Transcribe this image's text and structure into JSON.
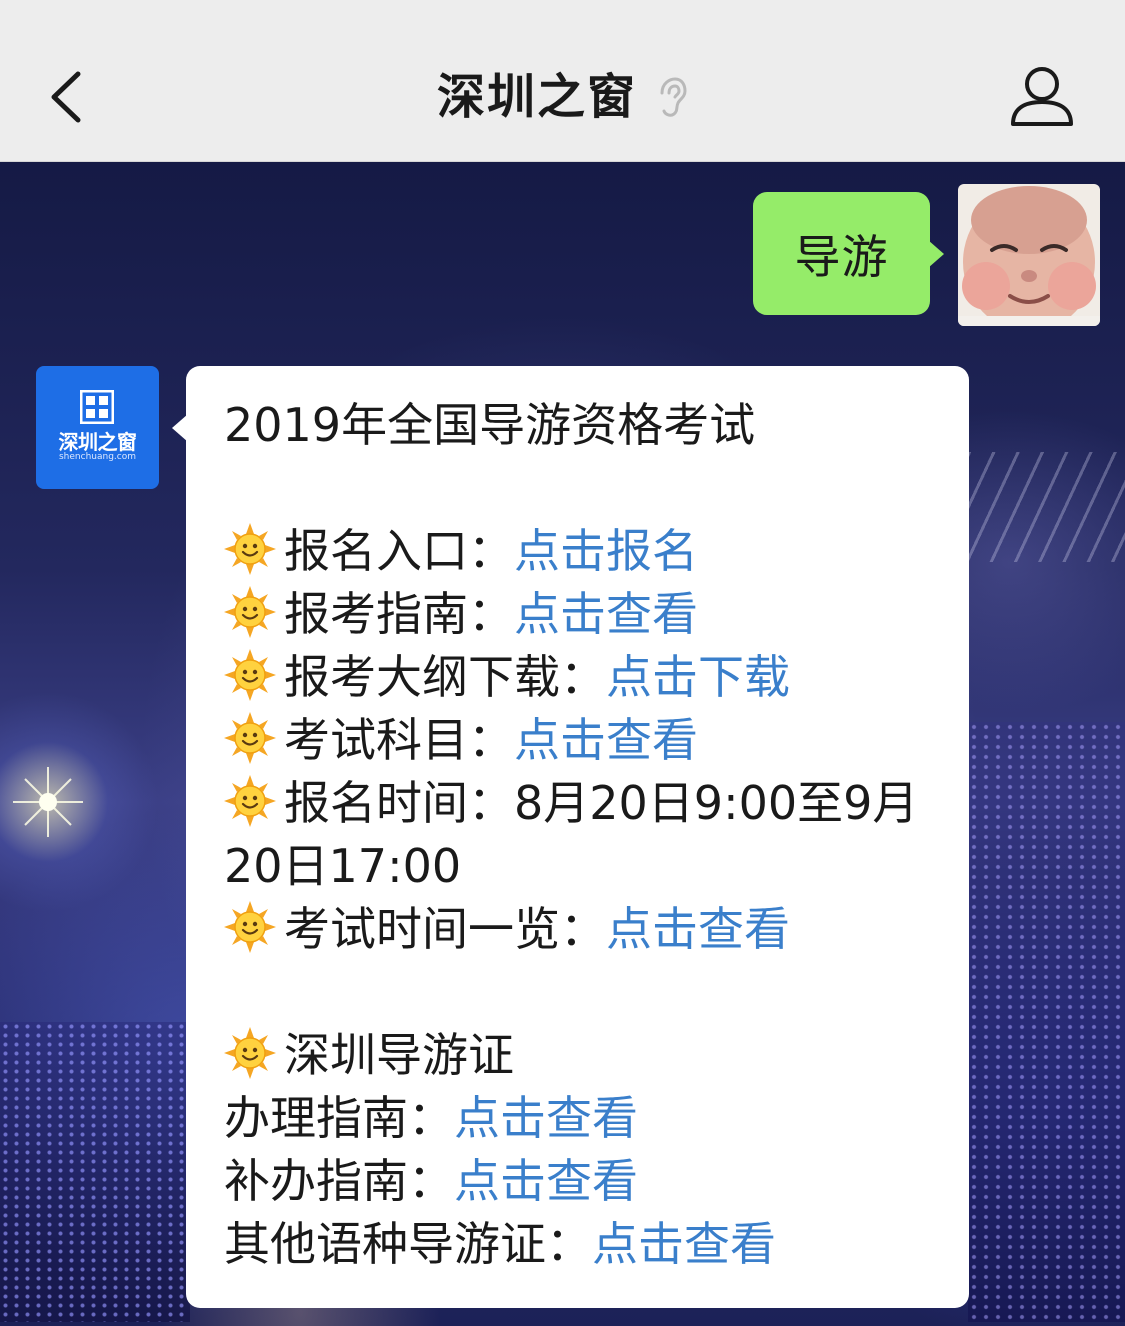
{
  "navbar": {
    "title": "深圳之窗",
    "back_icon": "chevron-left-icon",
    "ear_icon": "ear-icon",
    "profile_icon": "person-icon"
  },
  "colors": {
    "navbar_bg": "#ededed",
    "outgoing_bubble": "#95ec69",
    "incoming_bubble": "#ffffff",
    "link": "#3a7fcb",
    "avatar_brand": "#1e6ee6"
  },
  "outgoing": {
    "text": "导游"
  },
  "sender": {
    "logo_text": "深圳之窗",
    "logo_sub": "shenchuang.com"
  },
  "message": {
    "title": "2019年全国导游资格考试",
    "items": [
      {
        "label": "报名入口：",
        "link": "点击报名"
      },
      {
        "label": "报考指南：",
        "link": "点击查看"
      },
      {
        "label": "报考大纲下载：",
        "link": "点击下载"
      },
      {
        "label": "考试科目：",
        "link": "点击查看"
      }
    ],
    "time_label": "报名时间：",
    "time_value": "8月20日9:00至9月20日17:00",
    "schedule": {
      "label": "考试时间一览：",
      "link": "点击查看"
    },
    "section2_title": "深圳导游证",
    "section2_items": [
      {
        "label": "办理指南：",
        "link": "点击查看"
      },
      {
        "label": "补办指南：",
        "link": "点击查看"
      },
      {
        "label": "其他语种导游证：",
        "link": "点击查看"
      }
    ]
  }
}
